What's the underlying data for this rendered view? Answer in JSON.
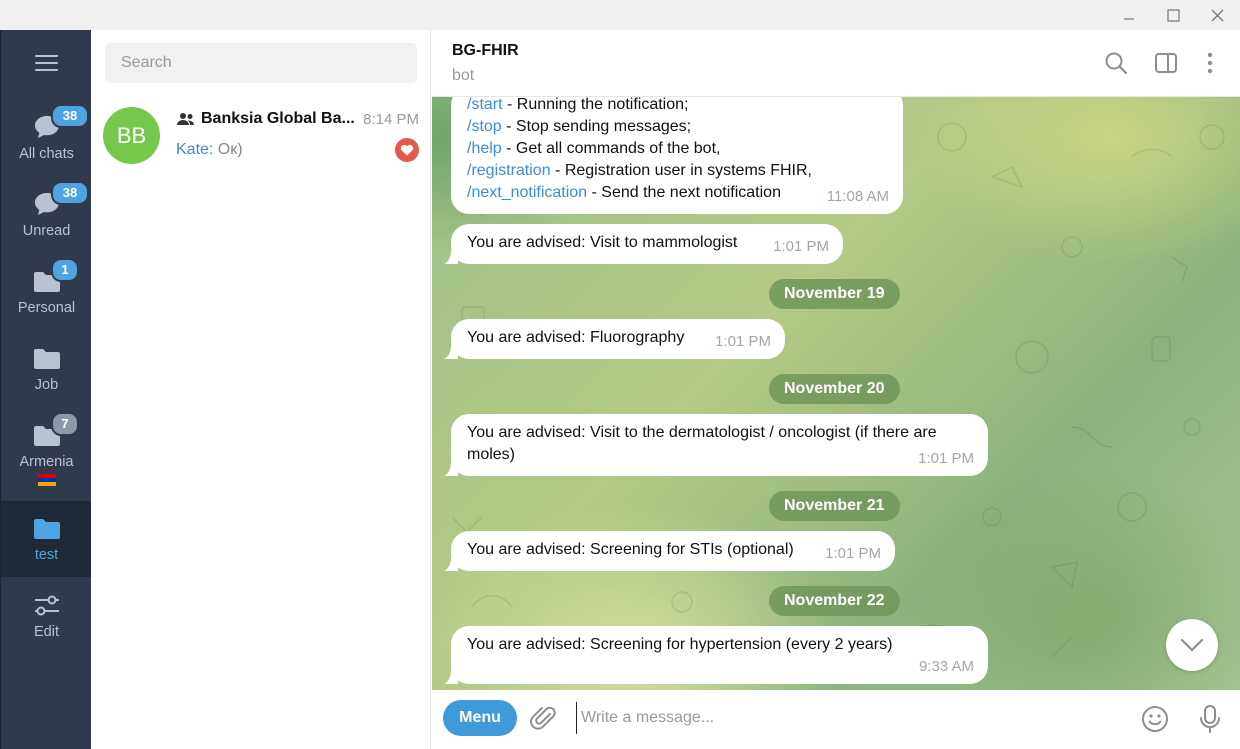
{
  "window": {
    "minimize_icon": "minimize-icon",
    "maximize_icon": "maximize-icon",
    "close_icon": "close-icon"
  },
  "folders": [
    {
      "label": "All chats",
      "badge": "38",
      "icon": "chats-icon"
    },
    {
      "label": "Unread",
      "badge": "38",
      "icon": "chats-icon"
    },
    {
      "label": "Personal",
      "badge": "1",
      "icon": "folder-icon"
    },
    {
      "label": "Job",
      "badge": "",
      "icon": "folder-icon"
    },
    {
      "label": "Armenia",
      "badge": "7",
      "icon": "folder-icon",
      "flag_colors": [
        "#d90012",
        "#0033a0",
        "#f2a800"
      ]
    },
    {
      "label": "test",
      "badge": "",
      "icon": "folder-icon",
      "active": true
    },
    {
      "label": "Edit",
      "badge": "",
      "icon": "sliders-icon"
    }
  ],
  "search": {
    "placeholder": "Search"
  },
  "chats": [
    {
      "initials": "BB",
      "name": "Banksia Global Ba...",
      "time": "8:14 PM",
      "sender": "Kate:",
      "preview": " Ок)",
      "avatar_color": "#76c84d"
    }
  ],
  "header": {
    "title": "BG-FHIR",
    "status": "bot"
  },
  "messages": [
    {
      "type": "commands",
      "lines": [
        {
          "cmd": "/start",
          "text": " - Running the notification;"
        },
        {
          "cmd": "/stop",
          "text": " - Stop sending messages;"
        },
        {
          "cmd": "/help",
          "text": " - Get all commands of the bot,"
        },
        {
          "cmd": "/registration",
          "text": " - Registration user in systems FHIR,"
        },
        {
          "cmd": "/next_notification",
          "text": " - Send the next notification"
        }
      ],
      "time": "11:08 AM"
    },
    {
      "type": "text",
      "text": "You are advised: Visit to mammologist",
      "time": "1:01 PM"
    },
    {
      "type": "date",
      "text": "November 19"
    },
    {
      "type": "text",
      "text": "You are advised: Fluorography",
      "time": "1:01 PM"
    },
    {
      "type": "date",
      "text": "November 20"
    },
    {
      "type": "text",
      "text": "You are advised: Visit to the dermatologist / oncologist (if there are moles)",
      "time": "1:01 PM"
    },
    {
      "type": "date",
      "text": "November 21"
    },
    {
      "type": "text",
      "text": "You are advised: Screening for STIs (optional)",
      "time": "1:01 PM"
    },
    {
      "type": "date",
      "text": "November 22"
    },
    {
      "type": "text",
      "text": "You are advised: Screening for hypertension (every 2 years)",
      "time": "9:33 AM"
    }
  ],
  "composer": {
    "menu_label": "Menu",
    "placeholder": "Write a message..."
  },
  "colors": {
    "accent": "#3f9ad9",
    "sidebar_bg": "#2f3b4c",
    "avatar": "#76c84d"
  }
}
